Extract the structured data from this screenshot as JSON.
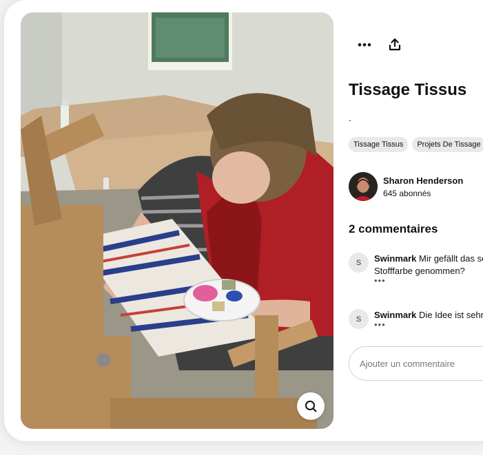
{
  "pin": {
    "title": "Tissage Tissus",
    "description": ".",
    "tags": [
      "Tissage Tissus",
      "Projets De Tissage"
    ]
  },
  "author": {
    "name": "Sharon Henderson",
    "followers": "645 abonnés"
  },
  "comments": {
    "heading": "2 commentaires",
    "items": [
      {
        "initial": "S",
        "user": "Swinmark",
        "text": "Mir gefällt das se",
        "text2": "Stofffarbe genommen?",
        "more": "•••"
      },
      {
        "initial": "S",
        "user": "Swinmark",
        "text": "Die Idee ist sehr",
        "more": "•••"
      }
    ],
    "placeholder": "Ajouter un commentaire"
  },
  "icons": {
    "more": "more-horizontal-icon",
    "share": "share-icon",
    "lens": "visual-search-icon"
  }
}
